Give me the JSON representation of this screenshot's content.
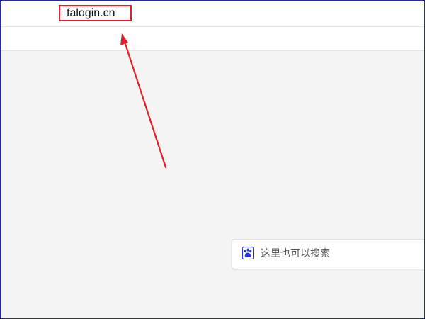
{
  "address_bar": {
    "url": "falogin.cn",
    "highlight_color": "#e0202a"
  },
  "search": {
    "placeholder": "这里也可以搜索",
    "icon": "paw-icon",
    "icon_color": "#2932e1"
  },
  "annotation": {
    "arrow_color": "#e0202a"
  }
}
